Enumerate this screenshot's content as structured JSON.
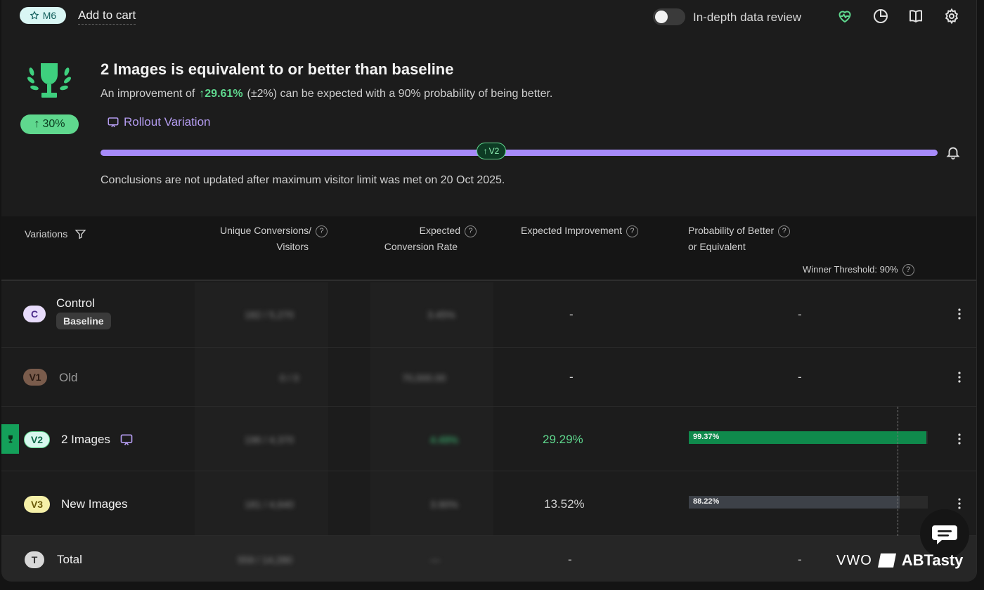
{
  "header": {
    "badge": "M6",
    "title": "Add to cart",
    "toggle_label": "In-depth data review",
    "toggle_on": false
  },
  "summary": {
    "uplift_badge": "30%",
    "headline": "2 Images is equivalent to or better than baseline",
    "sub_prefix": "An improvement of",
    "sub_value": "29.61%",
    "sub_suffix": "(±2%) can be expected with a 90% probability of being better.",
    "rollout_label": "Rollout Variation",
    "progress_marker": "V2",
    "note": "Conclusions are not updated after maximum visitor limit was met on 20 Oct 2025."
  },
  "table": {
    "headers": {
      "variations": "Variations",
      "conv_line1": "Unique Conversions/",
      "conv_line2": "Visitors",
      "rate_line1": "Expected",
      "rate_line2": "Conversion Rate",
      "improvement": "Expected Improvement",
      "prob_line1": "Probability of Better",
      "prob_line2": "or Equivalent",
      "threshold": "Winner Threshold: 90%"
    },
    "rows": [
      {
        "badge": "C",
        "name": "Control",
        "tag": "Baseline",
        "conv": "182 / 5,270",
        "rate": "3.45%",
        "improvement": "-",
        "probability": "-"
      },
      {
        "badge": "V1",
        "name": "Old",
        "conv": "0 / 0",
        "rate": "70,000.00",
        "improvement": "-",
        "probability": "-"
      },
      {
        "badge": "V2",
        "name": "2 Images",
        "conv": "196 / 4,370",
        "rate": "4.49%",
        "improvement": "29.29%",
        "probability": "99.37%",
        "prob_value": 0.9937
      },
      {
        "badge": "V3",
        "name": "New Images",
        "conv": "181 / 4,640",
        "rate": "3.90%",
        "improvement": "13.52%",
        "probability": "88.22%",
        "prob_value": 0.8822
      },
      {
        "badge": "T",
        "name": "Total",
        "conv": "559 / 14,280",
        "rate": "—",
        "improvement": "-",
        "probability": "-"
      }
    ]
  },
  "brand": {
    "vwo": "VWO",
    "abtasty": "ABTasty"
  },
  "colors": {
    "accent_purple": "#a78bfa",
    "success_green": "#5fd88e",
    "bar_green": "#0f8a4c",
    "bar_gray": "#3d4148"
  },
  "icons": [
    "star-icon",
    "heart-pulse-icon",
    "pie-chart-icon",
    "book-icon",
    "gear-icon",
    "trophy-icon",
    "rollout-icon",
    "bell-icon",
    "filter-icon",
    "help-icon",
    "kebab-icon",
    "chat-icon"
  ]
}
